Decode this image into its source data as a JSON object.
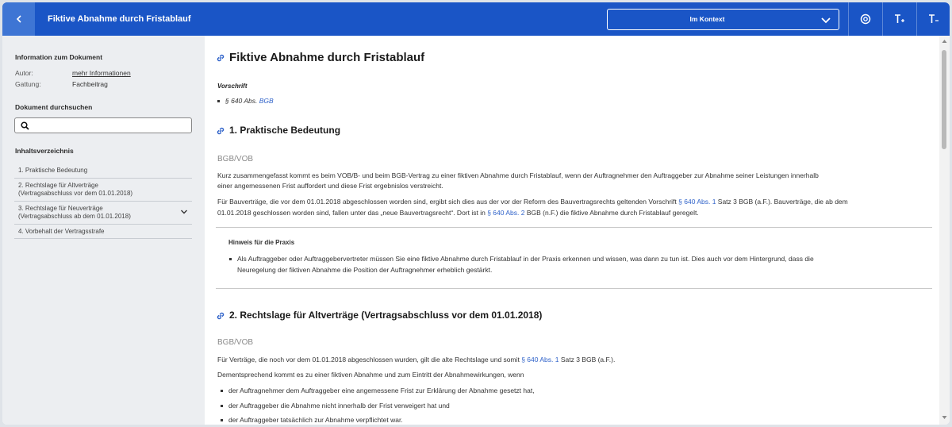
{
  "header": {
    "title": "Fiktive Abnahme durch Fristablauf",
    "context_select": "Im Kontext",
    "tools": [
      "target-icon",
      "font-increase-icon",
      "font-decrease-icon"
    ]
  },
  "sidebar": {
    "info_heading": "Information zum Dokument",
    "author_label": "Autor:",
    "author_value": "mehr Informationen",
    "genre_label": "Gattung:",
    "genre_value": "Fachbeitrag",
    "search_heading": "Dokument durchsuchen",
    "search_value": "",
    "toc_heading": "Inhaltsverzeichnis",
    "toc": [
      {
        "line1": "1. Praktische Bedeutung",
        "line2": ""
      },
      {
        "line1": "2. Rechtslage für Altverträge",
        "line2": "(Vertragsabschluss vor dem 01.01.2018)"
      },
      {
        "line1": "3. Rechtslage für Neuverträge",
        "line2": "(Vertragsabschluss ab dem 01.01.2018)"
      },
      {
        "line1": "4. Vorbehalt der Vertragsstrafe",
        "line2": ""
      }
    ]
  },
  "content": {
    "doc_title": "Fiktive Abnahme durch Fristablauf",
    "vorschrift_label": "Vorschrift",
    "vorschrift_text": "§ 640 Abs. ",
    "vorschrift_link": "BGB",
    "s1": {
      "heading": "1. Praktische Bedeutung",
      "tag": "BGB/VOB",
      "p1_l1": "Kurz zusammengefasst kommt es beim VOB/B- und beim BGB-Vertrag zu einer fiktiven Abnahme durch Fristablauf, wenn der Auftragnehmer den Auftraggeber zur Abnahme seiner Leistungen innerhalb",
      "p1_l2": "einer angemessenen Frist auffordert und diese Frist ergebnislos verstreicht.",
      "p2_l1a": "Für Bauverträge, die vor dem 01.01.2018 abgeschlossen worden sind, ergibt sich dies aus der vor der Reform des Bauvertragsrechts geltenden Vorschrift ",
      "p2_l1link": "§ 640 Abs. 1",
      "p2_l1b": " Satz 3 BGB (a.F.). Bauverträge, die ab dem",
      "p2_l2a": "01.01.2018 geschlossen worden sind, fallen unter das „neue Bauvertragsrecht“. Dort ist in ",
      "p2_l2link": "§ 640 Abs. 2",
      "p2_l2b": " BGB (n.F.) die fiktive Abnahme durch Fristablauf geregelt.",
      "hint_title": "Hinweis für die Praxis",
      "hint_l1": "Als Auftraggeber oder Auftraggebervertreter müssen Sie eine fiktive Abnahme durch Fristablauf in der Praxis erkennen und wissen, was dann zu tun ist. Dies auch vor dem Hintergrund, dass die",
      "hint_l2": "Neuregelung der fiktiven Abnahme die Position der Auftragnehmer erheblich gestärkt."
    },
    "s2": {
      "heading": "2. Rechtslage für Altverträge (Vertragsabschluss vor dem 01.01.2018)",
      "tag": "BGB/VOB",
      "p1a": "Für Verträge, die noch vor dem 01.01.2018 abgeschlossen wurden, gilt die alte Rechtslage und somit ",
      "p1link": "§ 640 Abs. 1",
      "p1b": " Satz 3 BGB (a.F.).",
      "p2": "Dementsprechend kommt es zu einer fiktiven Abnahme und zum Eintritt der Abnahmewirkungen, wenn",
      "bullets": [
        "der Auftragnehmer dem Auftraggeber eine angemessene Frist zur Erklärung der Abnahme gesetzt hat,",
        "der Auftraggeber die Abnahme nicht innerhalb der Frist verweigert hat und",
        "der Auftraggeber tatsächlich zur Abnahme verpflichtet war."
      ]
    }
  }
}
